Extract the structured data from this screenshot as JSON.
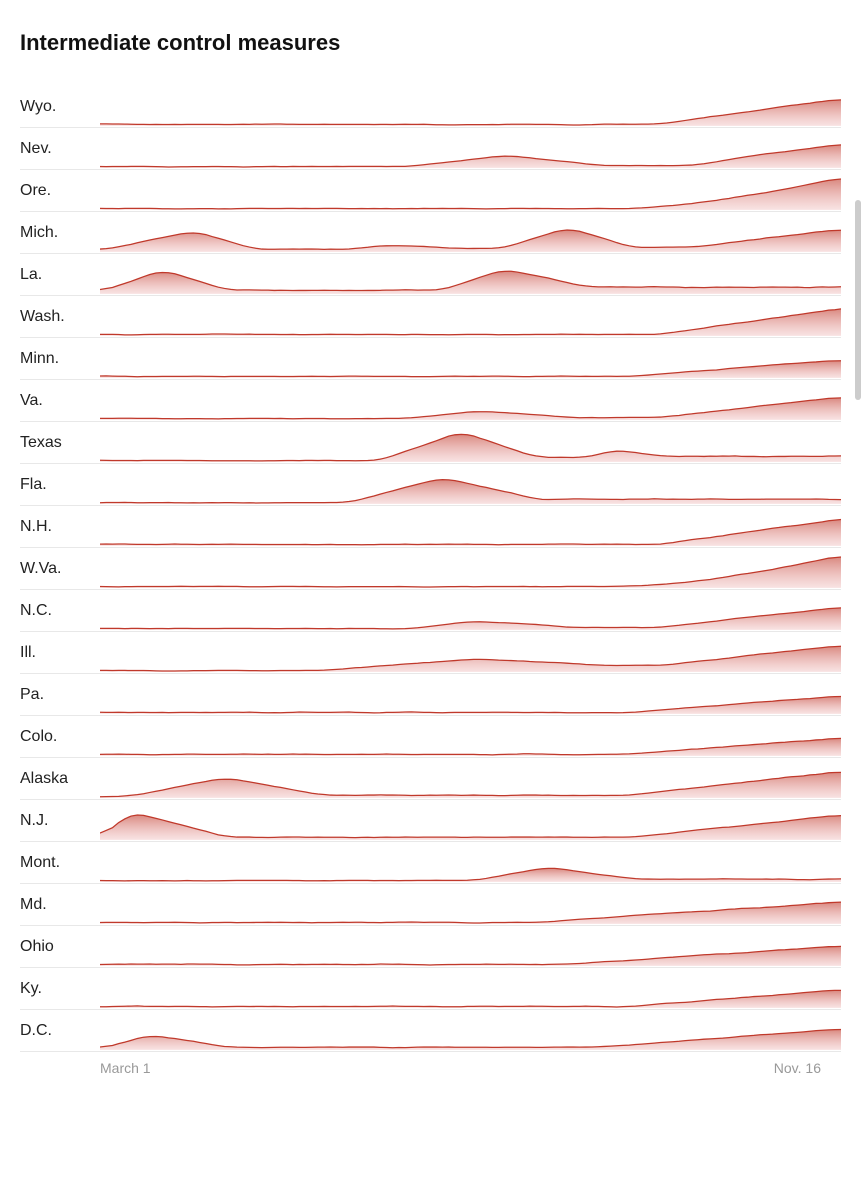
{
  "title": "Intermediate control measures",
  "xAxis": {
    "start": "March 1",
    "end": "Nov. 16"
  },
  "states": [
    {
      "label": "Wyo.",
      "pattern": "flat_rising_end"
    },
    {
      "label": "Nev.",
      "pattern": "flat_peak_mid_rising_end"
    },
    {
      "label": "Ore.",
      "pattern": "flat_rising_end_steep"
    },
    {
      "label": "Mich.",
      "pattern": "early_peak_mid_peak_rising_end"
    },
    {
      "label": "La.",
      "pattern": "early_peak_mid_peak"
    },
    {
      "label": "Wash.",
      "pattern": "flat_rising_end"
    },
    {
      "label": "Minn.",
      "pattern": "flat_mild_rising_end"
    },
    {
      "label": "Va.",
      "pattern": "flat_mid_bump_rising_end"
    },
    {
      "label": "Texas",
      "pattern": "flat_big_mid_peak_bump"
    },
    {
      "label": "Fla.",
      "pattern": "flat_mid_peak_mild_end"
    },
    {
      "label": "N.H.",
      "pattern": "flat_rising_end"
    },
    {
      "label": "W.Va.",
      "pattern": "flat_rising_end_steep"
    },
    {
      "label": "N.C.",
      "pattern": "flat_mid_bump_rising_end"
    },
    {
      "label": "Ill.",
      "pattern": "flat_mid_broad_rising_end"
    },
    {
      "label": "Pa.",
      "pattern": "flat_mild_rising_end"
    },
    {
      "label": "Colo.",
      "pattern": "flat_mild_rising_end"
    },
    {
      "label": "Alaska",
      "pattern": "early_peak_rising_end"
    },
    {
      "label": "N.J.",
      "pattern": "early_large_peak_rising_end"
    },
    {
      "label": "Mont.",
      "pattern": "flat_mid_bump"
    },
    {
      "label": "Md.",
      "pattern": "flat_broad_rising_end"
    },
    {
      "label": "Ohio",
      "pattern": "flat_mid_rising_end"
    },
    {
      "label": "Ky.",
      "pattern": "flat_mild_rising_end"
    },
    {
      "label": "D.C.",
      "pattern": "early_bump_flat_rising"
    }
  ]
}
